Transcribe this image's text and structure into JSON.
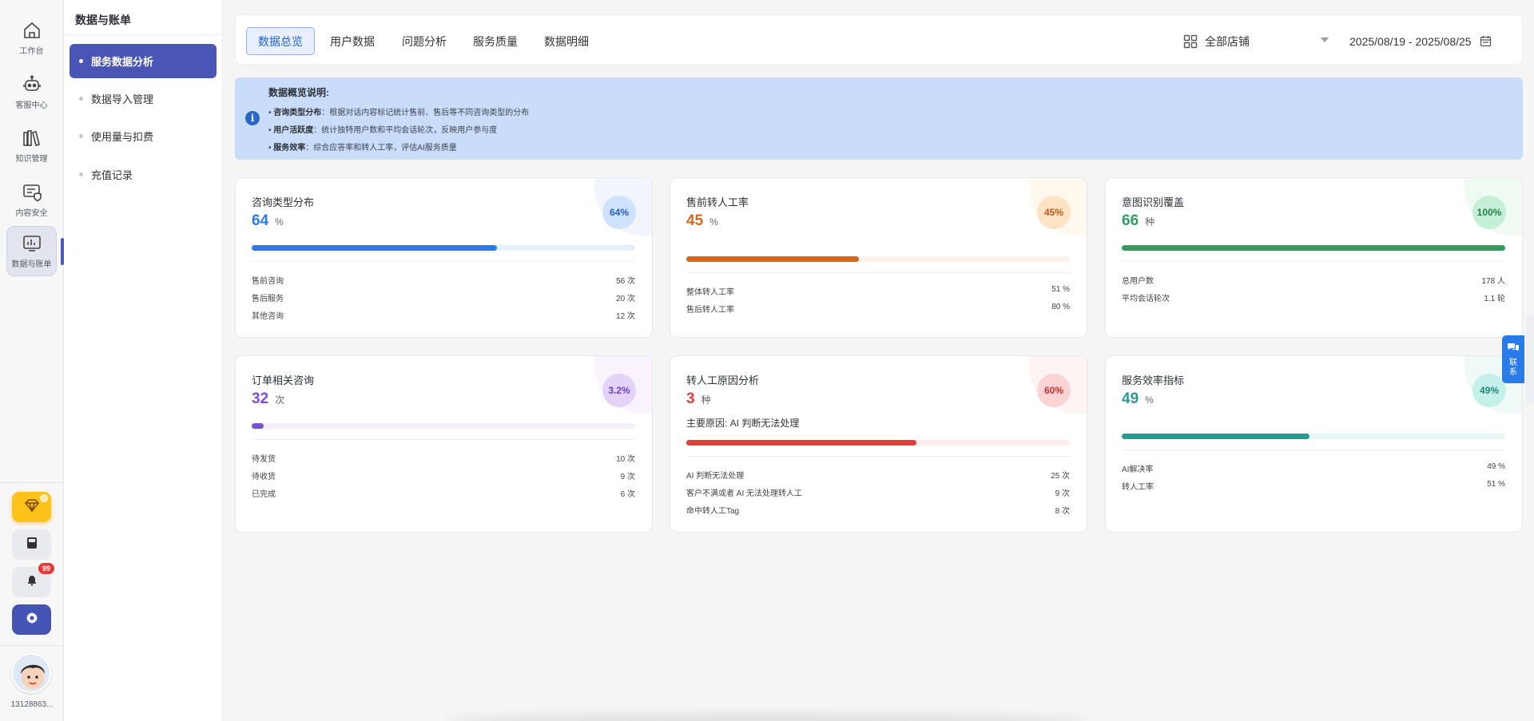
{
  "rail": {
    "items": [
      {
        "label": "工作台",
        "icon": "home-icon"
      },
      {
        "label": "客服中心",
        "icon": "robot-icon"
      },
      {
        "label": "知识管理",
        "icon": "books-icon"
      },
      {
        "label": "内容安全",
        "icon": "shield-chat-icon"
      },
      {
        "label": "数据与账单",
        "icon": "chart-icon"
      }
    ],
    "notification_count": "99",
    "user_id": "13128863..."
  },
  "subnav": {
    "title": "数据与账单",
    "items": [
      {
        "label": "服务数据分析"
      },
      {
        "label": "数据导入管理"
      },
      {
        "label": "使用量与扣费"
      },
      {
        "label": "充值记录"
      }
    ]
  },
  "tabs": [
    {
      "label": "数据总览"
    },
    {
      "label": "用户数据"
    },
    {
      "label": "问题分析"
    },
    {
      "label": "服务质量"
    },
    {
      "label": "数据明细"
    }
  ],
  "store_select": {
    "value": "全部店铺"
  },
  "date_range": {
    "value": "2025/08/19 - 2025/08/25"
  },
  "info": {
    "icon": "info-icon",
    "title": "数据概览说明:",
    "lines": [
      {
        "key": "咨询类型分布",
        "text": "：根据对话内容标记统计售前、售后等不同咨询类型的分布"
      },
      {
        "key": "用户活跃度",
        "text": "：统计独特用户数和平均会话轮次，反映用户参与度"
      },
      {
        "key": "服务效率",
        "text": "：综合应答率和转人工率，评估AI服务质量"
      }
    ]
  },
  "colors": {
    "blue": "#2a7bea",
    "orange": "#d9661f",
    "green": "#2f9e5e",
    "purple": "#7a4fd1",
    "red": "#e23c3c",
    "teal": "#2a9a90",
    "accent": "#4a56b6"
  },
  "cards": [
    {
      "title": "咨询类型分布",
      "value": "64",
      "unit": "%",
      "badge": "64%",
      "progress": 0.64,
      "rows": [
        {
          "label": "售前咨询",
          "value": "56 次"
        },
        {
          "label": "售后服务",
          "value": "20 次"
        },
        {
          "label": "其他咨询",
          "value": "12 次"
        }
      ]
    },
    {
      "title": "售前转人工率",
      "value": "45",
      "unit": "%",
      "badge": "45%",
      "progress": 0.45,
      "rows": [
        {
          "label": "整体转人工率",
          "value": "51 %"
        },
        {
          "label": "售后转人工率",
          "value": "80 %"
        }
      ]
    },
    {
      "title": "意图识别覆盖",
      "value": "66",
      "unit": "种",
      "badge": "100%",
      "progress": 1.0,
      "rows": [
        {
          "label": "总用户数",
          "value": "178 人"
        },
        {
          "label": "平均会话轮次",
          "value": "1.1 轮"
        }
      ]
    },
    {
      "title": "订单相关咨询",
      "value": "32",
      "unit": "次",
      "badge": "3.2%",
      "progress": 0.032,
      "rows": [
        {
          "label": "待发货",
          "value": "10 次"
        },
        {
          "label": "待收货",
          "value": "9 次"
        },
        {
          "label": "已完成",
          "value": "6 次"
        }
      ]
    },
    {
      "title": "转人工原因分析",
      "value": "3",
      "unit": "种",
      "badge": "60%",
      "progress": 0.6,
      "subtitle": "主要原因: AI 判断无法处理",
      "rows": [
        {
          "label": "AI 判断无法处理",
          "value": "25 次"
        },
        {
          "label": "客户不满或者 AI 无法处理转人工",
          "value": "9 次"
        },
        {
          "label": "命中转人工Tag",
          "value": "8 次"
        }
      ]
    },
    {
      "title": "服务效率指标",
      "value": "49",
      "unit": "%",
      "badge": "49%",
      "progress": 0.49,
      "rows": [
        {
          "label": "AI解决率",
          "value": "49 %"
        },
        {
          "label": "转人工率",
          "value": "51 %"
        }
      ]
    }
  ],
  "float_contact": {
    "label": "联系",
    "icon": "chat-bubbles-icon"
  }
}
